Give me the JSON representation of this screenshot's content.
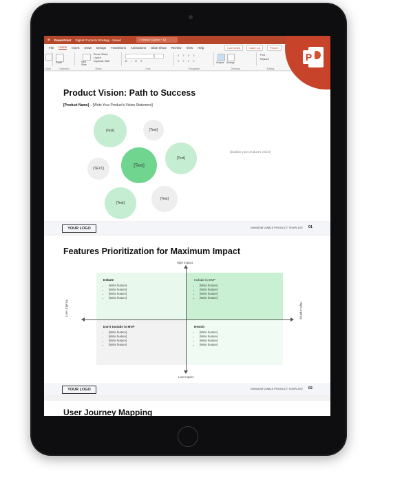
{
  "app": {
    "name": "PowerPoint",
    "doc_title": "Digital Products Strategy - Saved",
    "search_placeholder": "Search (Option + Q)"
  },
  "ribbon": {
    "tabs": [
      "File",
      "Home",
      "Insert",
      "Draw",
      "Design",
      "Transitions",
      "Animations",
      "Slide Show",
      "Review",
      "View",
      "Help"
    ],
    "active_tab": "Home",
    "comments_label": "Comments",
    "catchup_label": "Catch up",
    "present_label": "Presen",
    "groups": [
      "Undo",
      "Clipboard",
      "Slides",
      "Font",
      "Paragraph",
      "Drawing",
      "Editing"
    ],
    "new_slide_label": "New Slide",
    "reuse_slides_label": "Reuse Slides",
    "layout_label": "Layout",
    "duplicate_label": "Duplicate Slide",
    "shapes_label": "Shapes",
    "arrange_label": "Arrange",
    "find_label": "Find",
    "replace_label": "Replace",
    "paste_label": "Paste"
  },
  "colors": {
    "accent": "#b7472a",
    "bubble_light_green": "#c5edd1",
    "bubble_main_green": "#6fd58f",
    "bubble_grey": "#eeeeee",
    "quad_include": "#c9f0d3",
    "quad_debate": "#e9f8ed",
    "quad_revisit": "#f0fbf3",
    "quad_dont": "#f2f2f2"
  },
  "slide1": {
    "title": "Product Vision: Path to Success",
    "subtitle_bold": "[Product Name]",
    "subtitle_rest": " – [Write Your Product's Vision Statement]",
    "bubbles": [
      "[Text]",
      "[Text]",
      "[Text]",
      "[Text]",
      "[TEXT]",
      "[Text]",
      "[Text]"
    ],
    "explain": "[Explain your product's vision]",
    "logo": "YOUR LOGO",
    "footer_text": "MINIMUM VIABLE PRODUCT TEMPLATE",
    "page_num": "01"
  },
  "slide2": {
    "title": "Features Prioritization for Maximum Impact",
    "high_impact": "High Impact",
    "low_impact": "Low Impact",
    "low_urgency": "Low Urgency",
    "high_urgency": "High Urgency",
    "quadrants": [
      {
        "title": "Debate",
        "items": [
          "[Write feature]",
          "[Write feature]",
          "[Write feature]",
          "[Write feature]"
        ]
      },
      {
        "title": "Include in MVP",
        "items": [
          "[Write feature]",
          "[Write feature]",
          "[Write feature]",
          "[Write feature]"
        ]
      },
      {
        "title": "Don't Include in MVP",
        "items": [
          "[Write feature]",
          "[Write feature]",
          "[Write feature]",
          "[Write feature]"
        ]
      },
      {
        "title": "Revisit",
        "items": [
          "[Write feature]",
          "[Write feature]",
          "[Write feature]",
          "[Write feature]"
        ]
      }
    ],
    "logo": "YOUR LOGO",
    "footer_text": "MINIMUM VIABLE PRODUCT TEMPLATE",
    "page_num": "02"
  },
  "slide3": {
    "title": "User Journey Mapping"
  }
}
